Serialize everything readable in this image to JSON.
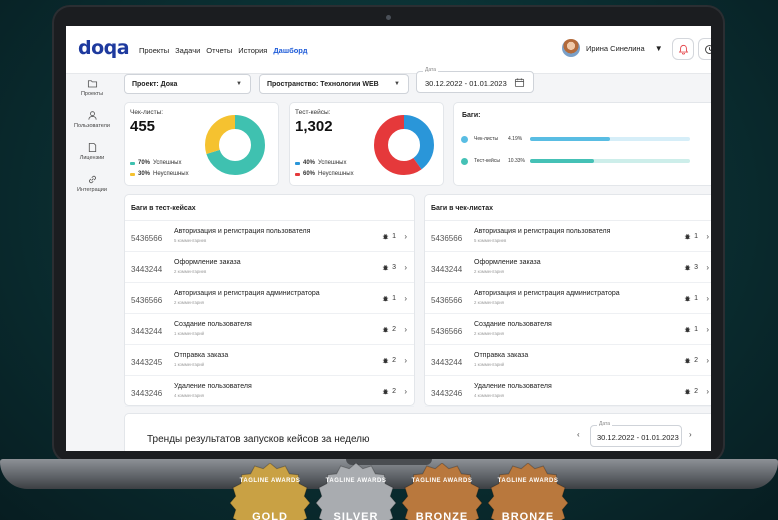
{
  "topnav": {
    "logo": "doqa",
    "links": [
      "Проекты",
      "Задачи",
      "Отчеты",
      "История",
      "Дашборд"
    ],
    "active_link": "Дашборд",
    "user_name": "Ирина Синелина"
  },
  "sidebar": {
    "items": [
      {
        "label": "Проекты",
        "icon": "folder-icon"
      },
      {
        "label": "Пользователи",
        "icon": "user-icon"
      },
      {
        "label": "Лицензии",
        "icon": "license-icon"
      },
      {
        "label": "Интеграции",
        "icon": "link-icon"
      }
    ]
  },
  "filters": {
    "project": "Проект: Дока",
    "space": "Пространство: Технологии WEB",
    "date_label": "Дата",
    "date_value": "30.12.2022 - 01.01.2023"
  },
  "kpis": {
    "checklists": {
      "label": "Чек-листы:",
      "value": "455",
      "success_pct": "70%",
      "success_label": "Успешных",
      "fail_pct": "30%",
      "fail_label": "Неуспешных",
      "success_fraction": 0.7,
      "colors": {
        "success": "#3fc1b0",
        "fail": "#f5c230"
      }
    },
    "testcases": {
      "label": "Тест-кейсы:",
      "value": "1,302",
      "success_pct": "40%",
      "success_label": "Успешных",
      "fail_pct": "60%",
      "fail_label": "Неуспешных",
      "success_fraction": 0.4,
      "colors": {
        "success": "#2a96d9",
        "fail": "#e5393b"
      }
    }
  },
  "bugs": {
    "title": "Баги:",
    "rows": [
      {
        "name": "Чек-листы",
        "pct": "4.19%",
        "fill": 0.5,
        "color": "#59bde3",
        "track": "#d6eef8"
      },
      {
        "name": "Тест-кейсы",
        "pct": "10.33%",
        "fill": 0.4,
        "color": "#45c1b6",
        "track": "#cdeeea"
      }
    ]
  },
  "list_testcases": {
    "title": "Баги в тест-кейсах",
    "rows": [
      {
        "id": "5436566",
        "title": "Авторизация и регистрация пользователя",
        "sub": "5 комментариев",
        "count": "1"
      },
      {
        "id": "3443244",
        "title": "Оформление заказа",
        "sub": "2 комментариев",
        "count": "3"
      },
      {
        "id": "5436566",
        "title": "Авторизация и регистрация администратора",
        "sub": "2 комментария",
        "count": "1"
      },
      {
        "id": "3443244",
        "title": "Создание пользователя",
        "sub": "1 комментарий",
        "count": "2"
      },
      {
        "id": "3443245",
        "title": "Отправка заказа",
        "sub": "1 комментарий",
        "count": "2"
      },
      {
        "id": "3443246",
        "title": "Удаление пользователя",
        "sub": "4 комментария",
        "count": "2"
      }
    ]
  },
  "list_checklists": {
    "title": "Баги в чек-листах",
    "rows": [
      {
        "id": "5436566",
        "title": "Авторизация и регистрация пользователя",
        "sub": "5 комментариев",
        "count": "1"
      },
      {
        "id": "3443244",
        "title": "Оформление заказа",
        "sub": "2 комментария",
        "count": "3"
      },
      {
        "id": "5436566",
        "title": "Авторизация и регистрация администратора",
        "sub": "2 комментария",
        "count": "1"
      },
      {
        "id": "5436566",
        "title": "Создание пользователя",
        "sub": "2 комментария",
        "count": "1"
      },
      {
        "id": "3443244",
        "title": "Отправка заказа",
        "sub": "1 комментарий",
        "count": "2"
      },
      {
        "id": "3443246",
        "title": "Удаление пользователя",
        "sub": "4 комментария",
        "count": "2"
      }
    ]
  },
  "trends": {
    "title": "Тренды результатов запусков кейсов за неделю",
    "date_label": "Дата",
    "date_value": "30.12.2022 - 01.01.2023"
  },
  "awards": [
    {
      "top": "TAGLINE AWARDS",
      "main": "GOLD",
      "color": "#c9a144"
    },
    {
      "top": "TAGLINE AWARDS",
      "main": "SILVER",
      "color": "#a9acb0"
    },
    {
      "top": "TAGLINE AWARDS",
      "main": "BRONZE",
      "color": "#b9783d"
    },
    {
      "top": "TAGLINE AWARDS",
      "main": "BRONZE",
      "color": "#b9783d"
    }
  ]
}
